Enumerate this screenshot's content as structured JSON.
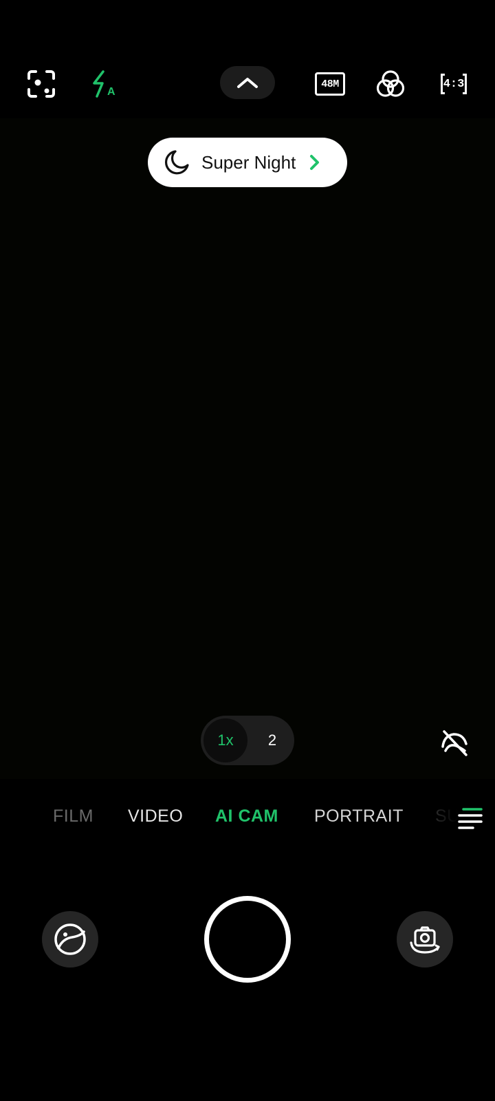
{
  "top_bar": {
    "flash_mode_letter": "A",
    "resolution_label": "48M",
    "aspect_ratio_label": "4:3"
  },
  "scene_chip": {
    "label": "Super Night"
  },
  "zoom": {
    "options": [
      "1x",
      "2"
    ],
    "selected": "1x"
  },
  "modes": {
    "items": [
      "FILM",
      "VIDEO",
      "AI CAM",
      "PORTRAIT",
      "SU"
    ],
    "selected": "AI CAM"
  },
  "colors": {
    "accent": "#20c26a",
    "background": "#000000",
    "chip_background": "#ffffff"
  },
  "icons": {
    "top": [
      "scan-icon",
      "flash-auto-icon",
      "chevron-up-icon",
      "resolution-48m-icon",
      "filter-icon",
      "aspect-ratio-icon"
    ],
    "scene": "moon-icon",
    "ai_toggle": "ai-scene-off-icon",
    "menu": "menu-icon",
    "bottom": [
      "gallery-icon",
      "shutter-icon",
      "flip-camera-icon"
    ]
  }
}
